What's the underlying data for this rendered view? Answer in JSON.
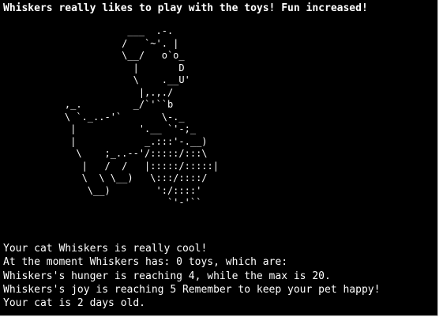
{
  "terminal": {
    "headline": "Whiskers really likes to play with the toys! Fun increased!",
    "ascii_art": "               ___  .-.\n              /   `~'. |\n              \\__/   o`o_\n                |       D\n                \\    .__U'\n                 |,.,./\n    ,_.         _/`'``b\n    \\ `._..-'`       \\-._\n     |           '.__ `'-;_\n     |            _.:::'-.__)\n      \\    ;_..--'/:::::/:::\\\n       |   /  /   |:::::/:::::|\n       \\  \\ \\__)   \\:::/::::/\n        \\__)        ':/::::'\n                      `'-'``",
    "status_lines": [
      "Your cat Whiskers is really cool!",
      "At the moment Whiskers has: 0 toys, which are:",
      "Whiskers's hunger is reaching 4, while the max is 20.",
      "Whiskers's joy is reaching 5 Remember to keep your pet happy!",
      "Your cat is 2 days old."
    ]
  },
  "colors": {
    "background": "#000000",
    "text": "#ffffff",
    "frame": "#ffffff"
  }
}
